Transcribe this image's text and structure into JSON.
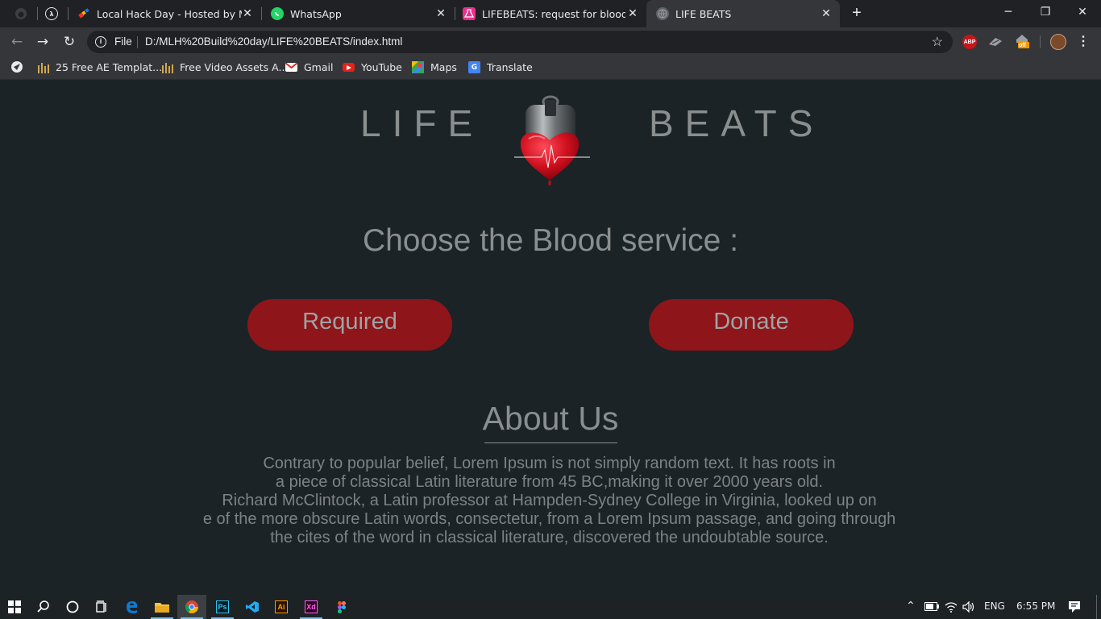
{
  "browser": {
    "tabs": [
      {
        "label": "",
        "icon": "github-icon"
      },
      {
        "label": "",
        "icon": "lambda-icon"
      },
      {
        "label": "Local Hack Day - Hosted by MLH",
        "icon": "mlh-icon"
      },
      {
        "label": "WhatsApp",
        "icon": "whatsapp-icon"
      },
      {
        "label": "LIFEBEATS: request for blood - Ar",
        "icon": "flask-icon"
      },
      {
        "label": "LIFE BEATS",
        "icon": "globe-icon"
      }
    ],
    "new_tab": "+",
    "window_controls": {
      "minimize": "─",
      "restore": "❐",
      "close": "✕"
    },
    "address": {
      "scheme": "File",
      "url": "D:/MLH%20Build%20day/LIFE%20BEATS/index.html"
    },
    "extensions": [
      {
        "name": "adblock-icon",
        "label": "ABP",
        "color": "#c4161c"
      },
      {
        "name": "extension-icon",
        "label": "",
        "color": "#9aa0a6"
      },
      {
        "name": "off-badge-icon",
        "label": "off",
        "color": "#f29900"
      },
      {
        "name": "profile-avatar",
        "label": "",
        "color": "#7a4a2a"
      }
    ],
    "bookmarks": [
      {
        "label": "",
        "icon": "apps-icon"
      },
      {
        "label": "25 Free AE Templat...",
        "icon": "bars-icon"
      },
      {
        "label": "Free Video Assets A...",
        "icon": "bars-icon"
      },
      {
        "label": "Gmail",
        "icon": "gmail-icon"
      },
      {
        "label": "YouTube",
        "icon": "youtube-icon"
      },
      {
        "label": "Maps",
        "icon": "maps-icon"
      },
      {
        "label": "Translate",
        "icon": "translate-icon"
      }
    ]
  },
  "page": {
    "brand_left": "LIFE",
    "brand_right": "BEATS",
    "heading": "Choose the Blood service :",
    "buttons": {
      "required": "Required",
      "donate": "Donate"
    },
    "about_title": "About Us",
    "about_lines": [
      "Contrary to popular belief, Lorem Ipsum is not simply random text. It has roots in",
      "a piece of classical Latin literature from 45 BC,making it over 2000 years old.",
      "Richard McClintock, a Latin professor at Hampden-Sydney College in Virginia, looked up on",
      "e of the more obscure Latin words, consectetur, from a Lorem Ipsum passage, and going through",
      "the cites of the word in classical literature, discovered the undoubtable source."
    ],
    "colors": {
      "background": "#1b2327",
      "button": "#8e1519",
      "text": "#8a8e8f"
    }
  },
  "taskbar": {
    "apps": [
      "windows-start-icon",
      "search-icon",
      "cortana-icon",
      "task-view-icon",
      "edge-icon",
      "file-explorer-icon",
      "chrome-icon",
      "photoshop-icon",
      "vscode-icon",
      "illustrator-icon",
      "xd-icon",
      "figma-icon"
    ],
    "app_labels": {
      "photoshop": "Ps",
      "illustrator": "Ai",
      "xd": "Xd"
    },
    "language": "ENG",
    "time": "6:55 PM"
  }
}
